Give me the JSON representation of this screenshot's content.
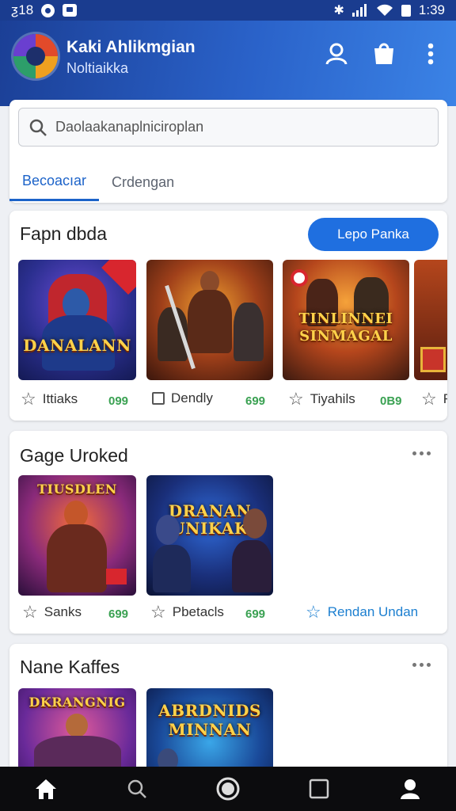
{
  "status_bar": {
    "left_text": "ƺ18",
    "time": "1:39"
  },
  "header": {
    "title": "Kaki Ahlikmgian",
    "subtitle": "Noltiaikka"
  },
  "search": {
    "value": "Daolaakanaplniciroplan"
  },
  "tabs": [
    {
      "label": "Becoacıar",
      "active": true
    },
    {
      "label": "Crdengan",
      "active": false
    }
  ],
  "sections": [
    {
      "title": "Fapn dbda",
      "button_label": "Lepo Panka",
      "items": [
        {
          "art_text": "DANALANN",
          "name": "Ittiaks",
          "price": "099"
        },
        {
          "art_text": "",
          "name": "Dendly",
          "price": "699"
        },
        {
          "art_text": "TINLINNEI SINMAGAL",
          "name": "Tiyahils",
          "price": "0B9"
        },
        {
          "art_text": "",
          "name": "Re",
          "price": ""
        }
      ]
    },
    {
      "title": "Gage Uroked",
      "link_label": "Rendan Undan",
      "items": [
        {
          "art_text": "TIUSDLEN",
          "name": "Sanks",
          "price": "699"
        },
        {
          "art_text": "DRANAN UNIKAK",
          "name": "Pbetacls",
          "price": "699"
        }
      ]
    },
    {
      "title": "Nane Kaffes",
      "items": [
        {
          "art_text": "DKRANGNIG"
        },
        {
          "art_text": "ABRDNIDS MINNAN"
        }
      ]
    }
  ],
  "colors": {
    "primary": "#1f6fe0",
    "header_dark": "#1b3f96",
    "price_green": "#3aa152",
    "nav_bg": "#0c0c0e"
  },
  "bottom_nav": [
    "home-icon",
    "search-icon",
    "record-icon",
    "square-icon",
    "profile-icon"
  ]
}
